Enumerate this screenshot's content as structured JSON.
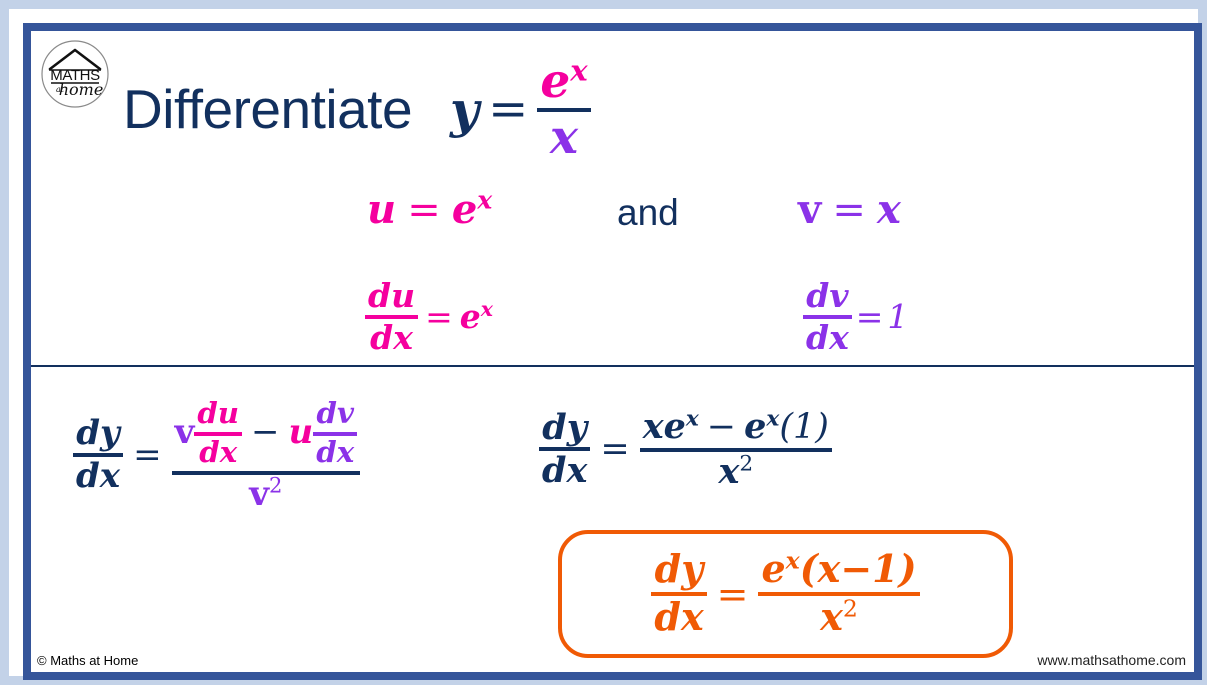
{
  "slide": {
    "title_text": "Differentiate",
    "colors": {
      "navy": "#12305e",
      "magenta": "#f5009e",
      "purple": "#8b32e8",
      "orange": "#f05a05",
      "frame_blue": "#35559a",
      "outer_band": "#c3d2e8"
    }
  },
  "logo": {
    "top_word": "MATHS",
    "small_word": "at",
    "script_word": "home",
    "alt": "Maths at Home circular logo"
  },
  "title_equation": {
    "lhs": "y",
    "equals": "=",
    "numerator": "e",
    "numerator_exponent": "x",
    "denominator": "x"
  },
  "substitutions": {
    "u_label": "u",
    "u_equals": "=",
    "u_value_base": "e",
    "u_value_exponent": "x",
    "conjunction": "and",
    "v_label": "v",
    "v_equals": "=",
    "v_value": "x"
  },
  "derivatives": {
    "du_num_d": "d",
    "du_num_var": "u",
    "du_den_d": "d",
    "du_den_var": "x",
    "du_equals": "=",
    "du_value_base": "e",
    "du_value_exponent": "x",
    "dv_num_d": "d",
    "dv_num_var": "v",
    "dv_den_d": "d",
    "dv_den_var": "x",
    "dv_equals": "=",
    "dv_value": "1"
  },
  "quotient_rule": {
    "lhs_num_d": "d",
    "lhs_num_var": "y",
    "lhs_den_d": "d",
    "lhs_den_var": "x",
    "equals": "=",
    "term1_v": "v",
    "term1_num_d": "d",
    "term1_num_var": "u",
    "term1_den_d": "d",
    "term1_den_var": "x",
    "minus": "−",
    "term2_u": "u",
    "term2_num_d": "d",
    "term2_num_var": "v",
    "term2_den_d": "d",
    "term2_den_var": "x",
    "denominator_v": "v",
    "denominator_exponent": "2"
  },
  "working": {
    "lhs_num_d": "d",
    "lhs_num_var": "y",
    "lhs_den_d": "d",
    "lhs_den_var": "x",
    "equals": "=",
    "num_x": "x",
    "num_e": "e",
    "num_e_exponent": "x",
    "num_minus": "−",
    "num_e2": "e",
    "num_e2_exponent": "x",
    "num_paren": "(1)",
    "den_x": "x",
    "den_exponent": "2"
  },
  "answer": {
    "lhs_num_d": "d",
    "lhs_num_var": "y",
    "lhs_den_d": "d",
    "lhs_den_var": "x",
    "equals": "=",
    "num_e": "e",
    "num_e_exponent": "x",
    "num_paren": "(x−1)",
    "den_x": "x",
    "den_exponent": "2"
  },
  "footer": {
    "copyright": "© Maths at Home",
    "website": "www.mathsathome.com"
  }
}
